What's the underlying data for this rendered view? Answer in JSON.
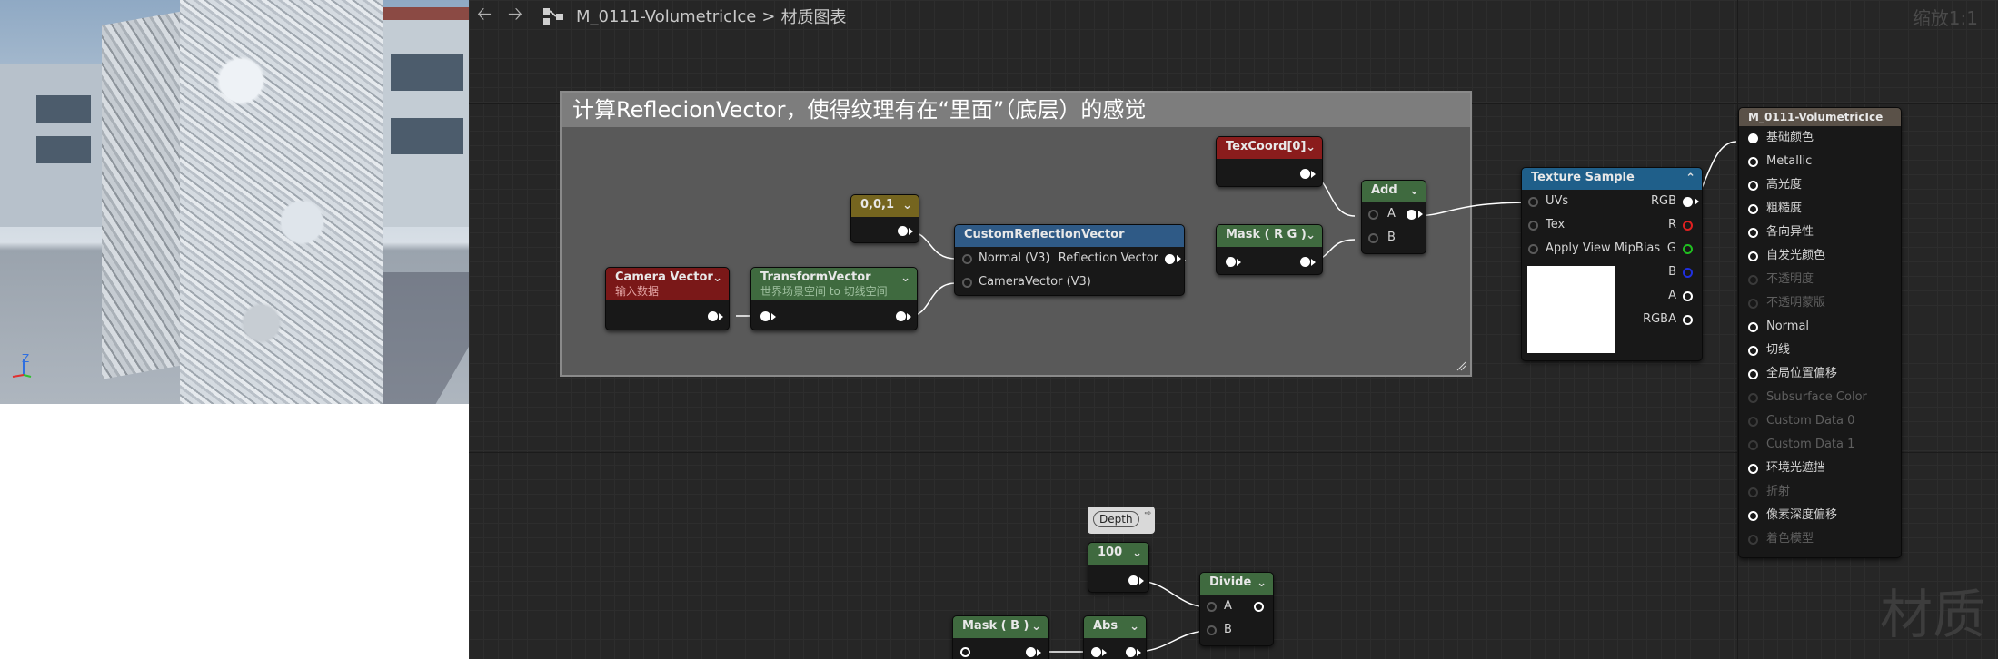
{
  "viewport": {
    "axis_label": "Z"
  },
  "toolbar": {
    "back_icon": "back-arrow-icon",
    "forward_icon": "forward-arrow-icon",
    "material_name": "M_0111-VolumetricIce",
    "separator": ">",
    "graph_label": "材质图表",
    "zoom": "缩放1:1"
  },
  "watermark": "材质",
  "comment": {
    "title": "计算ReflecionVector，使得纹理有在“里面”（底层）的感觉"
  },
  "nodes": {
    "camera_vector": {
      "title": "Camera Vector",
      "subtitle": "输入数据",
      "color": "#7a1818"
    },
    "transform_vector": {
      "title": "TransformVector",
      "subtitle": "世界场景空间 to 切线空间",
      "color": "#3f6a3f"
    },
    "constant3": {
      "title": "0,0,1",
      "color": "#75651f"
    },
    "custom_reflection": {
      "title": "CustomReflectionVector",
      "inputs": [
        "Normal (V3)",
        "CameraVector (V3)"
      ],
      "output": "Reflection Vector",
      "color": "#2f5a86"
    },
    "texcoord": {
      "title": "TexCoord[0]",
      "color": "#8a1c1c"
    },
    "mask_rg": {
      "title": "Mask ( R G )",
      "color": "#3f6a3f"
    },
    "add": {
      "title": "Add",
      "inputs": [
        "A",
        "B"
      ],
      "color": "#3f6a3f"
    },
    "texture_sample": {
      "title": "Texture Sample",
      "inputs": [
        "UVs",
        "Tex",
        "Apply View MipBias"
      ],
      "outputs": [
        "RGB",
        "R",
        "G",
        "B",
        "A",
        "RGBA"
      ],
      "color": "#1f5f8a"
    },
    "result": {
      "title": "M_0111-VolumetricIce",
      "pins": [
        {
          "label": "基础颜色",
          "enabled": true,
          "connected": true
        },
        {
          "label": "Metallic",
          "enabled": true,
          "connected": false
        },
        {
          "label": "高光度",
          "enabled": true,
          "connected": false
        },
        {
          "label": "粗糙度",
          "enabled": true,
          "connected": false
        },
        {
          "label": "各向异性",
          "enabled": true,
          "connected": false
        },
        {
          "label": "自发光颜色",
          "enabled": true,
          "connected": false
        },
        {
          "label": "不透明度",
          "enabled": false,
          "connected": false
        },
        {
          "label": "不透明蒙版",
          "enabled": false,
          "connected": false
        },
        {
          "label": "Normal",
          "enabled": true,
          "connected": false
        },
        {
          "label": "切线",
          "enabled": true,
          "connected": false
        },
        {
          "label": "全局位置偏移",
          "enabled": true,
          "connected": false
        },
        {
          "label": "Subsurface Color",
          "enabled": false,
          "connected": false
        },
        {
          "label": "Custom Data 0",
          "enabled": false,
          "connected": false
        },
        {
          "label": "Custom Data 1",
          "enabled": false,
          "connected": false
        },
        {
          "label": "环境光遮挡",
          "enabled": true,
          "connected": false
        },
        {
          "label": "折射",
          "enabled": false,
          "connected": false
        },
        {
          "label": "像素深度偏移",
          "enabled": true,
          "connected": false
        },
        {
          "label": "着色模型",
          "enabled": false,
          "connected": false
        }
      ]
    },
    "depth_bubble": {
      "label": "Depth"
    },
    "const_100": {
      "title": "100",
      "color": "#3f6a3f"
    },
    "divide": {
      "title": "Divide",
      "inputs": [
        "A",
        "B"
      ],
      "color": "#3f6a3f"
    },
    "mask_b": {
      "title": "Mask ( B )",
      "color": "#3f6a3f"
    },
    "abs": {
      "title": "Abs",
      "color": "#3f6a3f"
    }
  },
  "colors": {
    "pin_r": "#e02020",
    "pin_g": "#20c020",
    "pin_b": "#2030e0",
    "graph_bg": "#262626",
    "comment_bg": "#595959"
  }
}
